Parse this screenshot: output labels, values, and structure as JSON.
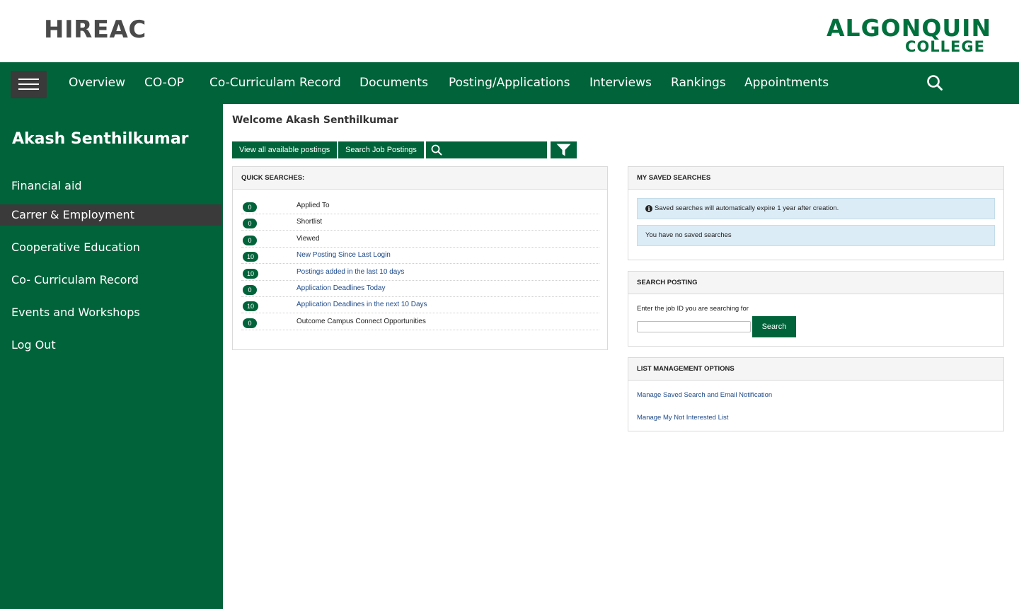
{
  "header": {
    "brand": "HIREAC",
    "logo_line1": "ALGONQUIN",
    "logo_line2": "COLLEGE"
  },
  "nav": {
    "menu_icon": "hamburger-icon",
    "items": [
      "Overview",
      "CO-OP",
      "Co-Curriculam Record",
      "Documents",
      "Posting/Applications",
      "Interviews",
      "Rankings",
      "Appointments"
    ],
    "search_icon": "search-icon"
  },
  "sidebar": {
    "user_name": "Akash Senthilkumar",
    "items": [
      {
        "label": "Financial aid",
        "active": false
      },
      {
        "label": "Carrer & Employment",
        "active": true
      },
      {
        "label": "Cooperative Education",
        "active": false
      },
      {
        "label": "Co- Curriculam Record",
        "active": false
      },
      {
        "label": "Events and Workshops",
        "active": false
      },
      {
        "label": "Log Out",
        "active": false
      }
    ]
  },
  "main": {
    "welcome": "Welcome Akash Senthilkumar",
    "toolbar": {
      "view_all": "View all available postings",
      "search_postings": "Search Job Postings",
      "search_icon": "search-icon",
      "filter_icon": "filter-icon"
    },
    "quick_searches": {
      "title": "QUICK SEARCHES:",
      "rows": [
        {
          "count": "0",
          "label": "Applied To",
          "link": false
        },
        {
          "count": "0",
          "label": "Shortlist",
          "link": false
        },
        {
          "count": "0",
          "label": "Viewed",
          "link": false
        },
        {
          "count": "10",
          "label": "New Posting Since Last Login",
          "link": true
        },
        {
          "count": "10",
          "label": "Postings added in the last 10 days",
          "link": true
        },
        {
          "count": "0",
          "label": "Application Deadlines Today",
          "link": true
        },
        {
          "count": "10",
          "label": "Application Deadlines in the next 10 Days",
          "link": true
        },
        {
          "count": "0",
          "label": "Outcome Campus Connect Opportunities",
          "link": false
        }
      ]
    },
    "saved_searches": {
      "title": "MY SAVED SEARCHES",
      "notice": "Saved searches will automatically expire 1 year after creation.",
      "empty": "You have no saved searches",
      "info_icon": "info-icon"
    },
    "search_posting": {
      "title": "SEARCH POSTING",
      "label": "Enter the job ID you are searching for",
      "input_value": "",
      "button": "Search"
    },
    "list_management": {
      "title": "LIST MANAGEMENT OPTIONS",
      "links": [
        "Manage Saved Search and Email Notification",
        "Manage My Not Interested List"
      ]
    }
  },
  "colors": {
    "primary_green": "#00633a",
    "logo_green": "#00703c",
    "active_item": "#3a3a3a",
    "info_bg": "#dcecf6",
    "link": "#1d4a8a"
  }
}
